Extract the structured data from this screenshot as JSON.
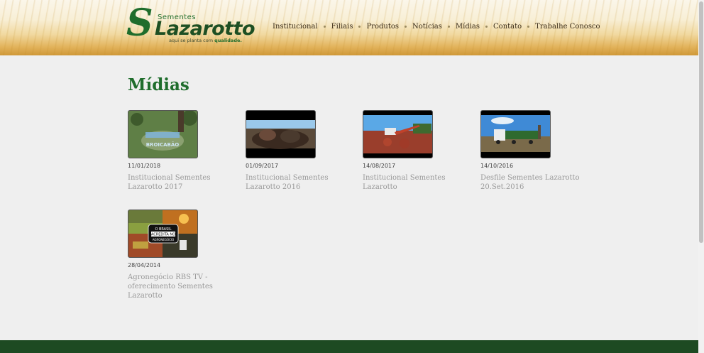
{
  "header": {
    "logo": {
      "brand_small": "Sementes",
      "brand_name": "Lazarotto",
      "tagline_prefix": "aqui se planta com",
      "tagline_bold": "qualidade."
    },
    "nav": [
      "Institucional",
      "Filiais",
      "Produtos",
      "Notícias",
      "Mídias",
      "Contato",
      "Trabalhe Conosco"
    ]
  },
  "page": {
    "title": "Mídias"
  },
  "videos": [
    {
      "date": "11/01/2018",
      "title": "Institucional Sementes Lazarotto 2017",
      "thumb_text": "BROICABÃO"
    },
    {
      "date": "01/09/2017",
      "title": "Institucional Sementes Lazarotto 2016"
    },
    {
      "date": "14/08/2017",
      "title": "Institucional Sementes Lazarotto"
    },
    {
      "date": "14/10/2016",
      "title": "Desfile Sementes Lazarotto 20.Set.2016"
    },
    {
      "date": "28/04/2014",
      "title": "Agronegócio RBS TV - oferecimento Sementes Lazarotto",
      "thumb_text": [
        "O BRASIL",
        "ACREDITA NO",
        "AGRONEGÓCIO"
      ]
    }
  ]
}
